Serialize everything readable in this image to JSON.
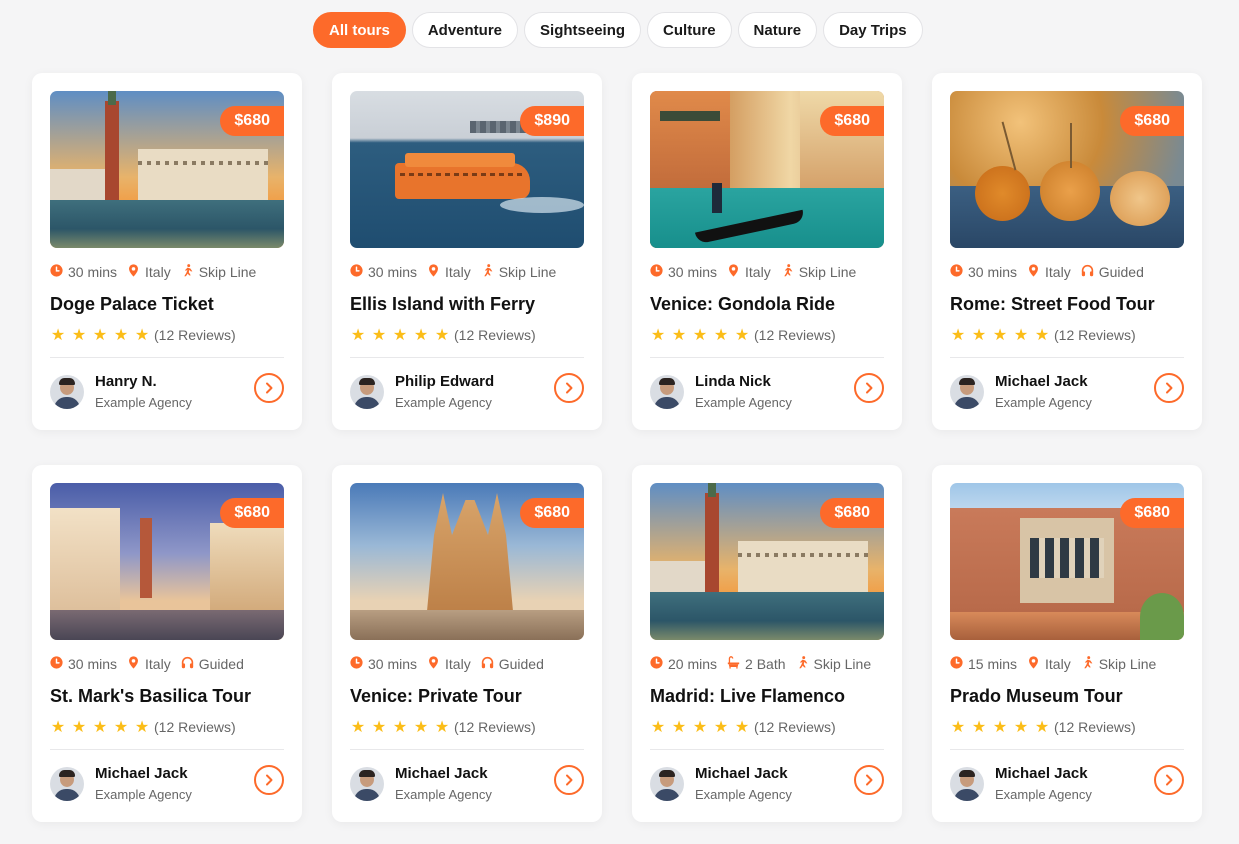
{
  "filters": [
    "All tours",
    "Adventure",
    "Sightseeing",
    "Culture",
    "Nature",
    "Day Trips"
  ],
  "active_filter": "All tours",
  "reviews_text": "(12 Reviews)",
  "stars": 5,
  "accent_color": "#fd6a2a",
  "star_color": "#fbbd18",
  "tours": [
    {
      "title": "Doge Palace Ticket",
      "price": "$680",
      "duration": "30 mins",
      "location": "Italy",
      "feature": "Skip Line",
      "feature_icon": "walking-icon",
      "location_icon": "map-pin-icon",
      "agent": "Hanry N.",
      "agency": "Example Agency",
      "image": "venice-doge-palace"
    },
    {
      "title": "Ellis Island with Ferry",
      "price": "$890",
      "duration": "30 mins",
      "location": "Italy",
      "feature": "Skip Line",
      "feature_icon": "walking-icon",
      "location_icon": "map-pin-icon",
      "agent": "Philip Edward",
      "agency": "Example Agency",
      "image": "ferry-harbor"
    },
    {
      "title": "Venice: Gondola Ride",
      "price": "$680",
      "duration": "30 mins",
      "location": "Italy",
      "feature": "Skip Line",
      "feature_icon": "walking-icon",
      "location_icon": "map-pin-icon",
      "agent": "Linda Nick",
      "agency": "Example Agency",
      "image": "venice-canal-gondola"
    },
    {
      "title": "Rome: Street Food Tour",
      "price": "$680",
      "duration": "30 mins",
      "location": "Italy",
      "feature": "Guided",
      "feature_icon": "headphones-icon",
      "location_icon": "map-pin-icon",
      "agent": "Michael Jack",
      "agency": "Example Agency",
      "image": "street-food"
    },
    {
      "title": "St. Mark's Basilica Tour",
      "price": "$680",
      "duration": "30 mins",
      "location": "Italy",
      "feature": "Guided",
      "feature_icon": "headphones-icon",
      "location_icon": "map-pin-icon",
      "agent": "Michael Jack",
      "agency": "Example Agency",
      "image": "st-marks-square"
    },
    {
      "title": "Venice: Private Tour",
      "price": "$680",
      "duration": "30 mins",
      "location": "Italy",
      "feature": "Guided",
      "feature_icon": "headphones-icon",
      "location_icon": "map-pin-icon",
      "agent": "Michael Jack",
      "agency": "Example Agency",
      "image": "sagrada-familia"
    },
    {
      "title": "Madrid: Live Flamenco",
      "price": "$680",
      "duration": "20 mins",
      "location": "2 Bath",
      "feature": "Skip Line",
      "feature_icon": "walking-icon",
      "location_icon": "bath-icon",
      "agent": "Michael Jack",
      "agency": "Example Agency",
      "image": "venice-doge-palace"
    },
    {
      "title": "Prado Museum Tour",
      "price": "$680",
      "duration": "15 mins",
      "location": "Italy",
      "feature": "Skip Line",
      "feature_icon": "walking-icon",
      "location_icon": "map-pin-icon",
      "agent": "Michael Jack",
      "agency": "Example Agency",
      "image": "prado-museum"
    }
  ]
}
